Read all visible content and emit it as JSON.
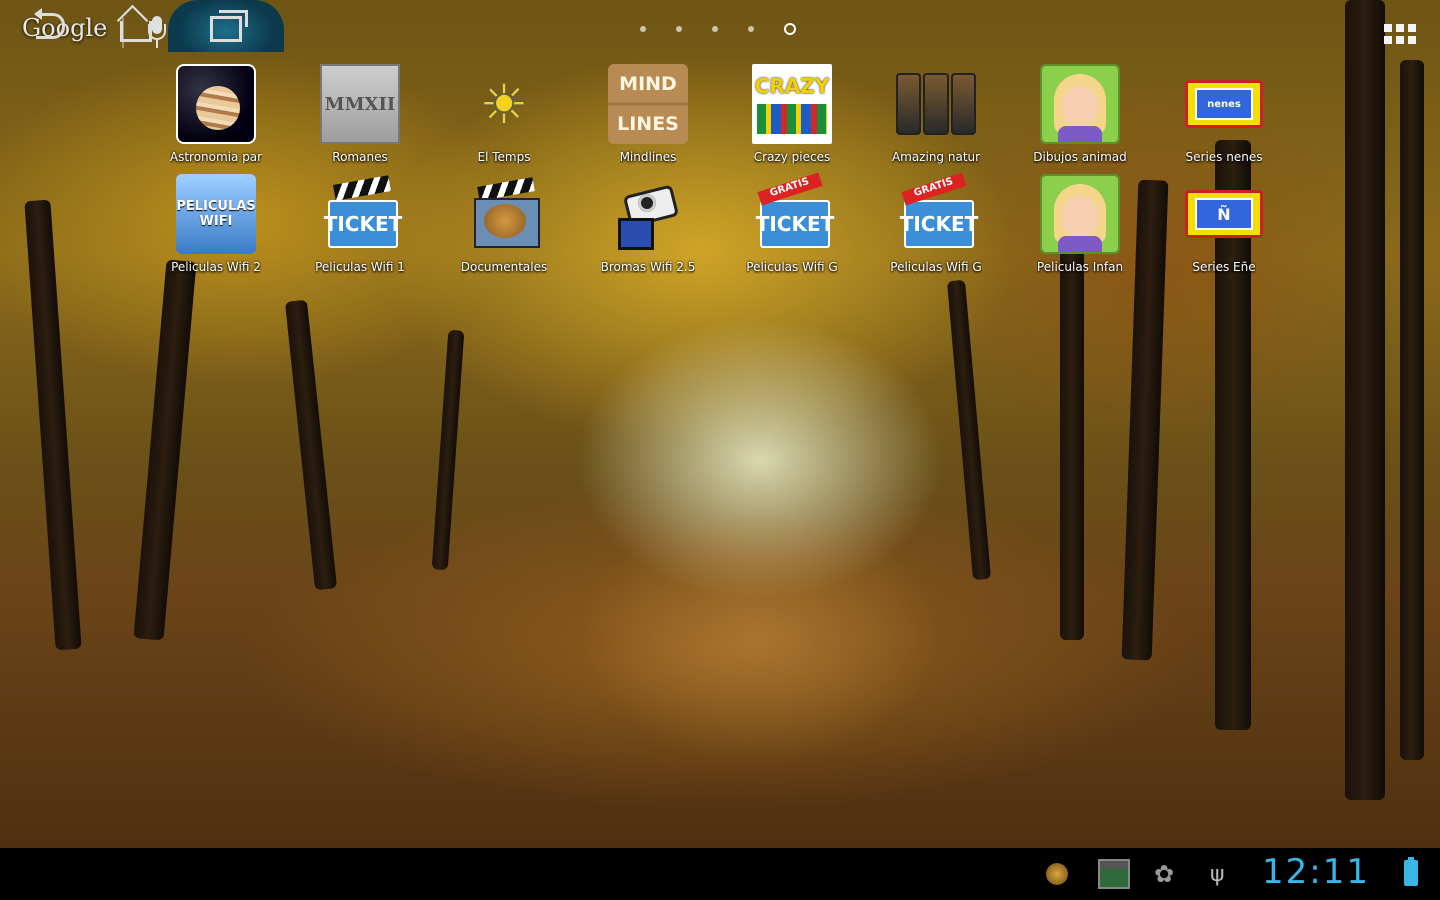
{
  "top_bar": {
    "google_label": "Google",
    "page_count": 5,
    "current_page": 5
  },
  "apps_row1": [
    {
      "label": "Astronomia par",
      "icon": "astronomy-icon"
    },
    {
      "label": "Romanes",
      "icon": "calendar-icon",
      "icon_text": "MMXII"
    },
    {
      "label": "El Temps",
      "icon": "weather-icon"
    },
    {
      "label": "Mindlines",
      "icon": "mindlines-icon",
      "icon_text_top": "MIND",
      "icon_text_bottom": "LINES"
    },
    {
      "label": "Crazy pieces",
      "icon": "crazy-pieces-icon",
      "icon_text": "CRAZY"
    },
    {
      "label": "Amazing natur",
      "icon": "phones-icon"
    },
    {
      "label": "Dibujos animad",
      "icon": "cartoon-girl-icon"
    },
    {
      "label": "Series nenes",
      "icon": "tv-icon",
      "icon_text": "nenes"
    }
  ],
  "apps_row2": [
    {
      "label": "Peliculas Wifi 2",
      "icon": "peliculas-wifi-icon",
      "icon_text_top": "PELICULAS",
      "icon_text_bottom": "WIFI"
    },
    {
      "label": "Peliculas Wifi 1",
      "icon": "ticket-icon",
      "icon_text": "TICKET"
    },
    {
      "label": "Documentales",
      "icon": "documentary-icon"
    },
    {
      "label": "Bromas Wifi 2.5",
      "icon": "camera-icon"
    },
    {
      "label": "Peliculas Wifi G",
      "icon": "ticket-gratis-icon",
      "icon_text": "TICKET",
      "badge": "GRATIS"
    },
    {
      "label": "Peliculas Wifi G",
      "icon": "ticket-gratis-icon",
      "icon_text": "TICKET",
      "badge": "GRATIS"
    },
    {
      "label": "Peliculas Infan",
      "icon": "cartoon-girl-icon"
    },
    {
      "label": "Series Eñe",
      "icon": "tv-icon",
      "icon_text": "Ñ"
    }
  ],
  "system_bar": {
    "clock": "12:11",
    "accent_color": "#39b6e6"
  }
}
